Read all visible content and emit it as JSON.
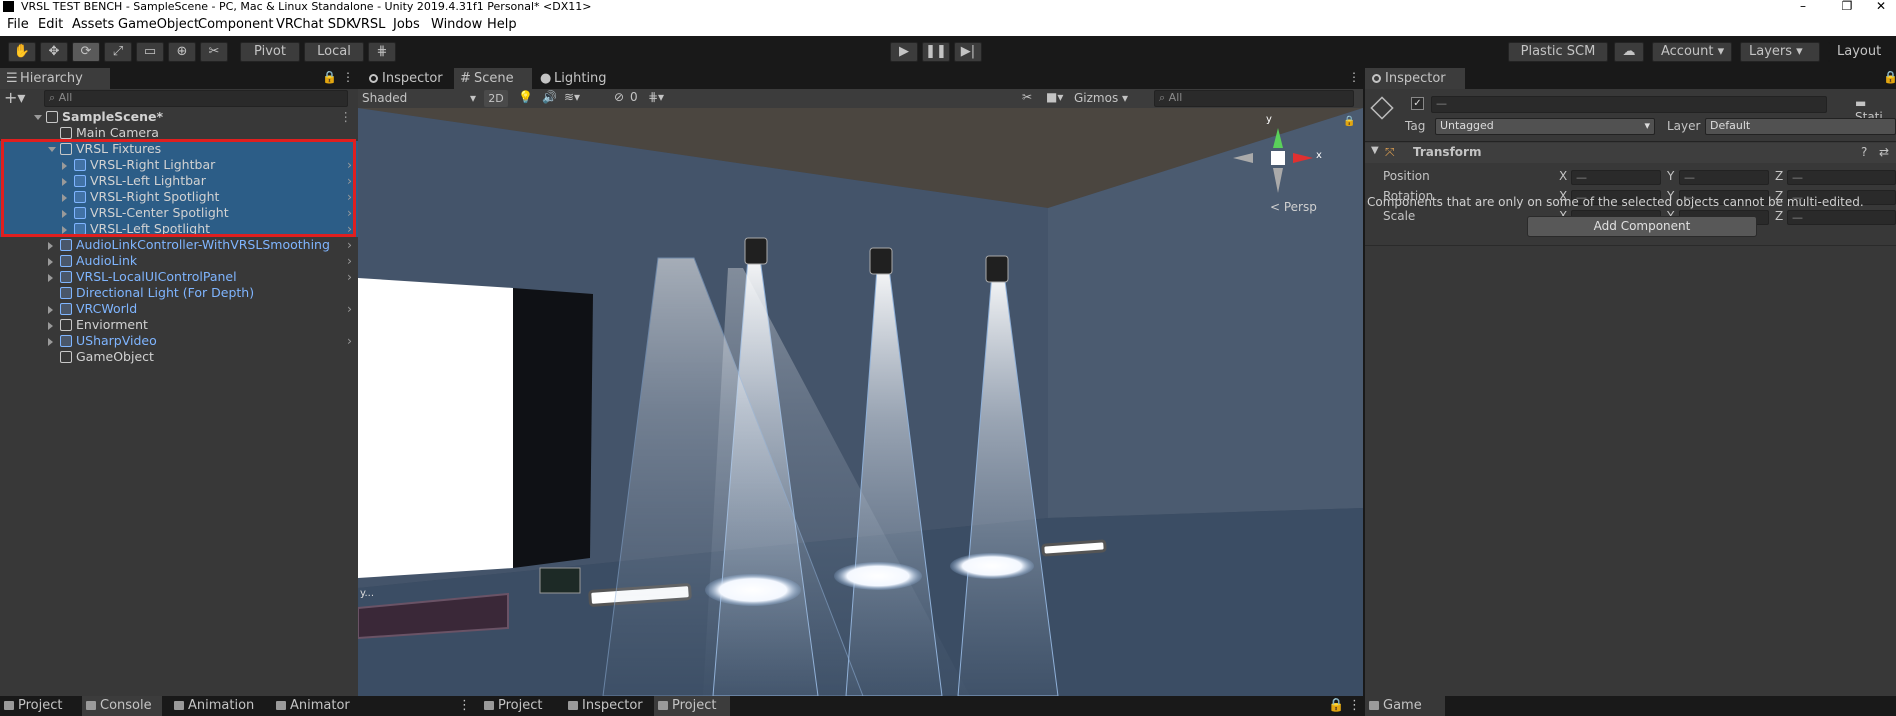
{
  "window": {
    "title": "VRSL TEST BENCH - SampleScene - PC, Mac & Linux Standalone - Unity 2019.4.31f1 Personal* <DX11>",
    "controls": [
      "–",
      "❐",
      "✕"
    ]
  },
  "menu": [
    "File",
    "Edit",
    "Assets",
    "GameObject",
    "Component",
    "VRChat SDK",
    "VRSL",
    "Jobs",
    "Window",
    "Help"
  ],
  "toolbar": {
    "pivot": "Pivot",
    "local": "Local",
    "plastic": "Plastic SCM",
    "account": "Account",
    "layers": "Layers",
    "layout": "Layout"
  },
  "hierarchy": {
    "tab": "Hierarchy",
    "search_placeholder": "All",
    "items": [
      {
        "label": "SampleScene*",
        "depth": 0,
        "expanded": true,
        "kind": "scene",
        "selected": false,
        "chevron": false
      },
      {
        "label": "Main Camera",
        "depth": 1,
        "expanded": null,
        "kind": "object",
        "selected": false,
        "chevron": false
      },
      {
        "label": "VRSL Fixtures",
        "depth": 1,
        "expanded": true,
        "kind": "object",
        "selected": true,
        "chevron": false
      },
      {
        "label": "VRSL-Right Lightbar",
        "depth": 2,
        "expanded": false,
        "kind": "prefab-white",
        "selected": true,
        "chevron": true
      },
      {
        "label": "VRSL-Left Lightbar",
        "depth": 2,
        "expanded": false,
        "kind": "prefab-white",
        "selected": true,
        "chevron": true
      },
      {
        "label": "VRSL-Right Spotlight",
        "depth": 2,
        "expanded": false,
        "kind": "prefab-white",
        "selected": true,
        "chevron": true
      },
      {
        "label": "VRSL-Center Spotlight",
        "depth": 2,
        "expanded": false,
        "kind": "prefab-white",
        "selected": true,
        "chevron": true
      },
      {
        "label": "VRSL-Left Spotlight",
        "depth": 2,
        "expanded": false,
        "kind": "prefab-white",
        "selected": true,
        "chevron": true
      },
      {
        "label": "AudioLinkController-WithVRSLSmoothing",
        "depth": 1,
        "expanded": false,
        "kind": "prefab",
        "selected": false,
        "chevron": true
      },
      {
        "label": "AudioLink",
        "depth": 1,
        "expanded": false,
        "kind": "prefab",
        "selected": false,
        "chevron": true
      },
      {
        "label": "VRSL-LocalUIControlPanel",
        "depth": 1,
        "expanded": false,
        "kind": "prefab",
        "selected": false,
        "chevron": true
      },
      {
        "label": "Directional Light (For Depth)",
        "depth": 1,
        "expanded": null,
        "kind": "prefab",
        "selected": false,
        "chevron": false
      },
      {
        "label": "VRCWorld",
        "depth": 1,
        "expanded": false,
        "kind": "prefab",
        "selected": false,
        "chevron": true
      },
      {
        "label": "Enviorment",
        "depth": 1,
        "expanded": false,
        "kind": "object",
        "selected": false,
        "chevron": false
      },
      {
        "label": "USharpVideo",
        "depth": 1,
        "expanded": false,
        "kind": "prefab",
        "selected": false,
        "chevron": true
      },
      {
        "label": "GameObject",
        "depth": 1,
        "expanded": null,
        "kind": "object",
        "selected": false,
        "chevron": false
      }
    ]
  },
  "center_tabs": [
    "Inspector",
    "Scene",
    "Lighting"
  ],
  "scene": {
    "shading": "Shaded",
    "mode_2d": "2D",
    "hidden_count": "0",
    "gizmos": "Gizmos",
    "search_placeholder": "All",
    "persp": "< Persp",
    "axis_y": "y",
    "axis_x": "x",
    "screen_text": "y..."
  },
  "inspector": {
    "tab": "Inspector",
    "name_value": "—",
    "static_label": "Stati",
    "tag_label": "Tag",
    "tag_value": "Untagged",
    "layer_label": "Layer",
    "layer_value": "Default",
    "component_title": "Transform",
    "rows": [
      {
        "label": "Position"
      },
      {
        "label": "Rotation"
      },
      {
        "label": "Scale"
      }
    ],
    "axes": [
      "X",
      "Y",
      "Z"
    ],
    "mixed": "—",
    "notice": "Components that are only on some of the selected objects cannot be multi-edited.",
    "add_component": "Add Component"
  },
  "bottom_tabs": {
    "left": [
      "Project",
      "Console",
      "Animation",
      "Animator"
    ],
    "middle": [
      "Project",
      "Inspector",
      "Project"
    ],
    "right": [
      "Game"
    ]
  }
}
